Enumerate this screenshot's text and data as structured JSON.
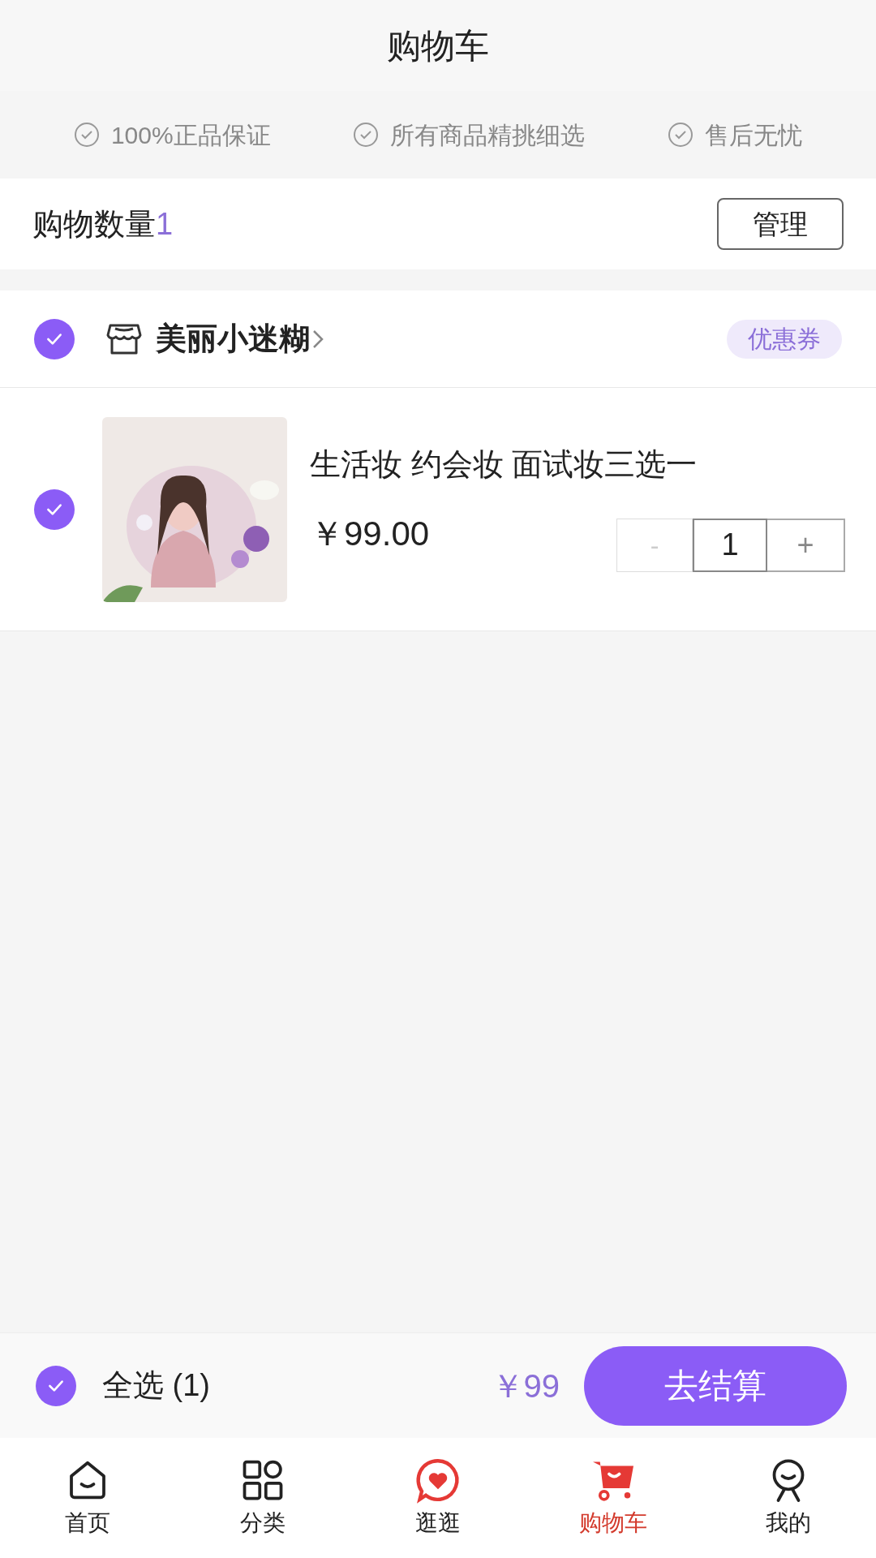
{
  "header": {
    "title": "购物车"
  },
  "guarantees": [
    "100%正品保证",
    "所有商品精挑细选",
    "售后无忧"
  ],
  "summary": {
    "label": "购物数量",
    "count": "1",
    "manage_button": "管理"
  },
  "store": {
    "name": "美丽小迷糊",
    "checked": true,
    "coupon": "优惠券"
  },
  "items": [
    {
      "checked": true,
      "title": "生活妆 约会妆 面试妆三选一",
      "price": "￥99.00",
      "minus": "-",
      "quantity": "1",
      "plus": "+"
    }
  ],
  "checkout_bar": {
    "select_all_checked": true,
    "select_all": "全选 (1)",
    "total": "￥99",
    "checkout_button": "去结算"
  },
  "tab_bar": [
    {
      "kind": "home",
      "label": "首页",
      "selected": false
    },
    {
      "kind": "category",
      "label": "分类",
      "selected": false
    },
    {
      "kind": "discover",
      "label": "逛逛",
      "selected": false
    },
    {
      "kind": "cart",
      "label": "购物车",
      "selected": true
    },
    {
      "kind": "profile",
      "label": "我的",
      "selected": false
    }
  ]
}
